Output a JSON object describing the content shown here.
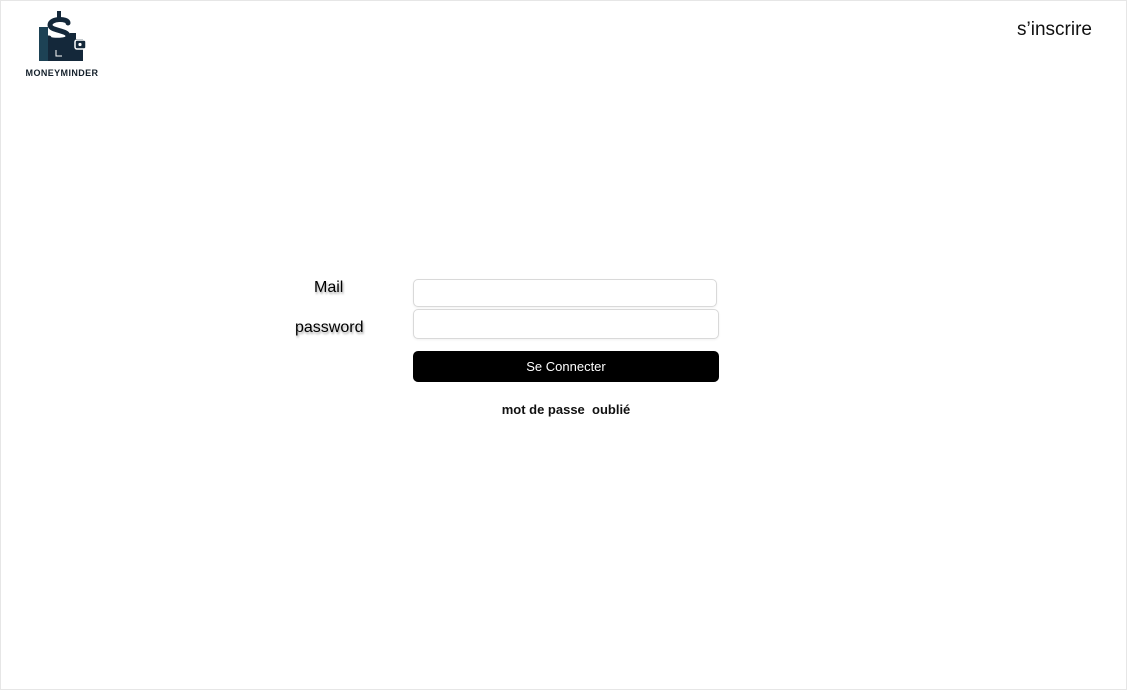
{
  "header": {
    "logo_icon": "wallet-dollar-icon",
    "logo_text": "MONEYMINDER",
    "signup_label": "s’inscrire",
    "brand_color": "#14283a"
  },
  "form": {
    "mail_label": "Mail",
    "mail_value": "",
    "password_label": "password",
    "password_value": "",
    "submit_label": "Se Connecter",
    "forgot_label": "mot de passe  oublié"
  }
}
